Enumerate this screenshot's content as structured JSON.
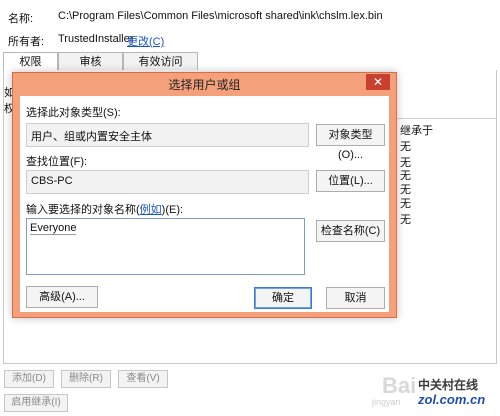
{
  "properties": {
    "name_label": "名称:",
    "name_value": "C:\\Program Files\\Common Files\\microsoft shared\\ink\\chslm.lex.bin",
    "owner_label": "所有者:",
    "owner_value": "TrustedInstaller",
    "owner_change_link": "更改(C)",
    "tabs": [
      {
        "label": "权限"
      },
      {
        "label": "审核"
      },
      {
        "label": "有效访问"
      }
    ],
    "side_fragments": [
      "如",
      "权"
    ],
    "inherit_header": "继承于",
    "inherit_values": [
      "无",
      "无",
      "无",
      "无",
      "无",
      "无"
    ],
    "buttons": {
      "add": "添加(D)",
      "remove": "删除(R)",
      "view": "查看(V)",
      "enable_inheritance": "启用继承(I)"
    }
  },
  "dialog": {
    "title": "选择用户或组",
    "close_glyph": "✕",
    "object_type_label": "选择此对象类型(S):",
    "object_type_value": "用户、组或内置安全主体",
    "object_types_button": "对象类型(O)...",
    "location_label": "查找位置(F):",
    "location_value": "CBS-PC",
    "location_button": "位置(L)...",
    "enter_names_label_pre": "输入要选择的对象名称(",
    "enter_names_label_link": "例如",
    "enter_names_label_post": ")(E):",
    "enter_names_value": "Everyone",
    "check_names_button": "检查名称(C)",
    "advanced_button": "高级(A)...",
    "ok_button": "确定",
    "cancel_button": "取消"
  },
  "watermark": {
    "brand": "Bai",
    "brand_sub": "jingyan",
    "site_cn": "中关村在线",
    "site_url": "zol.com.cn"
  },
  "colors": {
    "dialog_frame": "#f3a07b",
    "close_button": "#c8402f",
    "link": "#1a56c9"
  }
}
